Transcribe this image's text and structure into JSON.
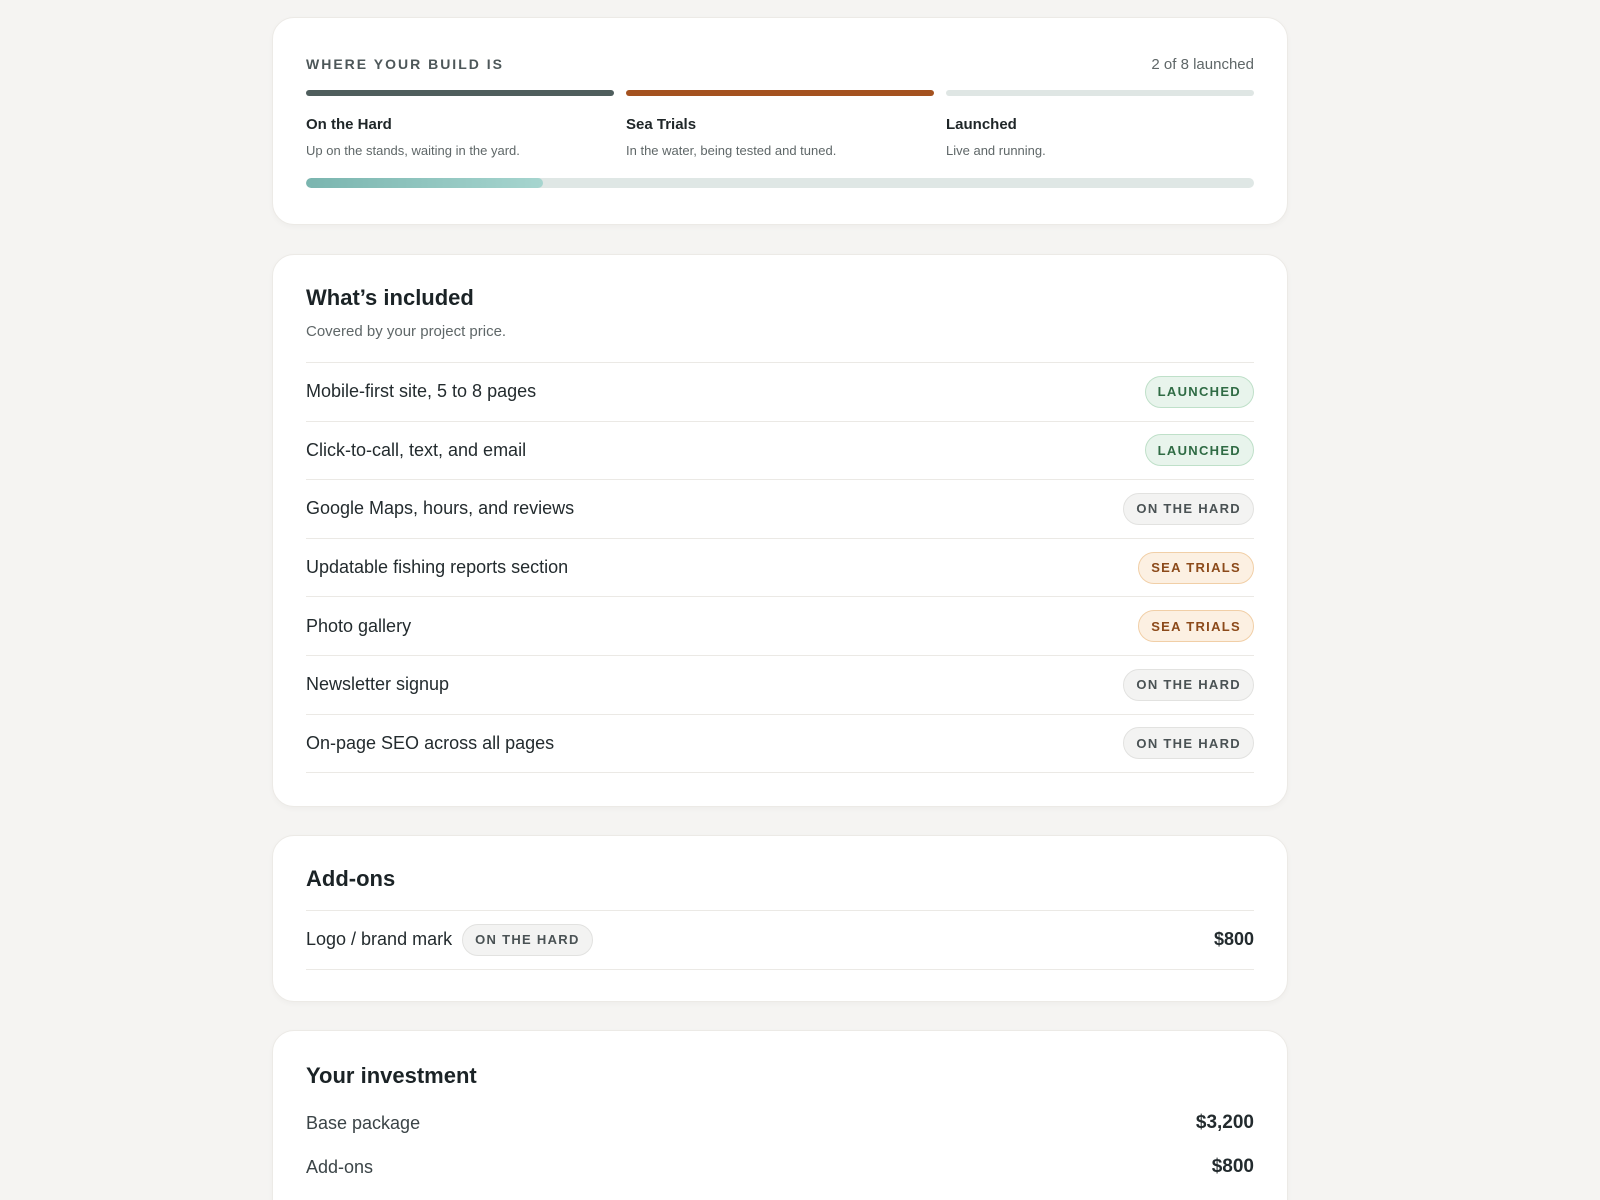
{
  "progress": {
    "eyebrow": "WHERE YOUR BUILD IS",
    "count_text": "2 of 8 launched",
    "overall_fraction": 0.25,
    "stages": [
      {
        "name": "On the Hard",
        "desc": "Up on the stands, waiting in the yard.",
        "color": "#4f5e5d"
      },
      {
        "name": "Sea Trials",
        "desc": "In the water, being tested and tuned.",
        "color": "#a4521f"
      },
      {
        "name": "Launched",
        "desc": "Live and running.",
        "color": "#dfe6e4"
      }
    ]
  },
  "included": {
    "title": "What’s included",
    "subtitle": "Covered by your project price.",
    "items": [
      {
        "label": "Mobile-first site, 5 to 8 pages",
        "status": "LAUNCHED",
        "kind": "launched"
      },
      {
        "label": "Click-to-call, text, and email",
        "status": "LAUNCHED",
        "kind": "launched"
      },
      {
        "label": "Google Maps, hours, and reviews",
        "status": "ON THE HARD",
        "kind": "hard"
      },
      {
        "label": "Updatable fishing reports section",
        "status": "SEA TRIALS",
        "kind": "sea"
      },
      {
        "label": "Photo gallery",
        "status": "SEA TRIALS",
        "kind": "sea"
      },
      {
        "label": "Newsletter signup",
        "status": "ON THE HARD",
        "kind": "hard"
      },
      {
        "label": "On-page SEO across all pages",
        "status": "ON THE HARD",
        "kind": "hard"
      }
    ]
  },
  "addons": {
    "title": "Add-ons",
    "items": [
      {
        "label": "Logo / brand mark",
        "status": "ON THE HARD",
        "kind": "hard",
        "price": "$800"
      }
    ]
  },
  "investment": {
    "title": "Your investment",
    "rows": [
      {
        "label": "Base package",
        "value": "$3,200"
      },
      {
        "label": "Add-ons",
        "value": "$800"
      }
    ]
  }
}
